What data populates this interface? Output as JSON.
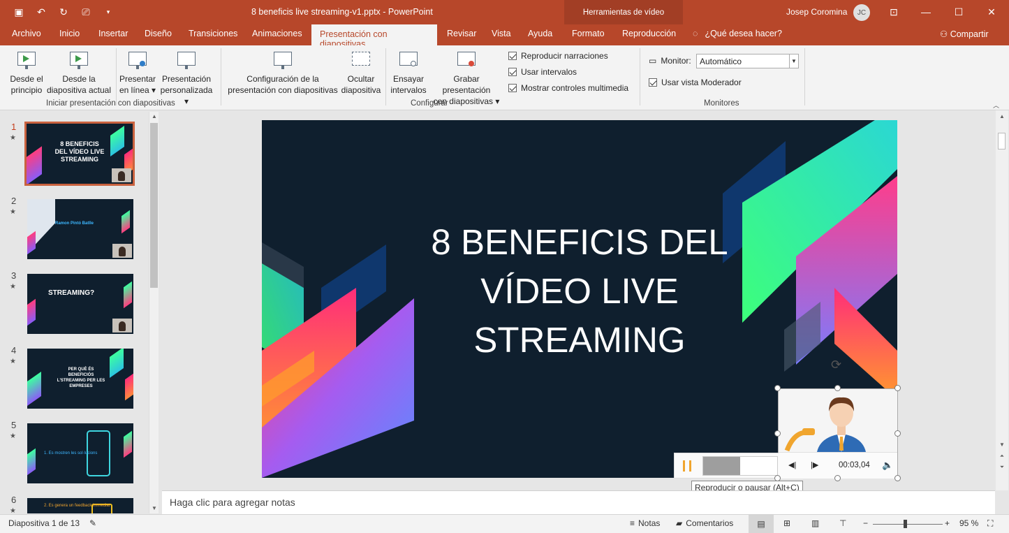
{
  "window": {
    "doc_title": "8 beneficis live streaming-v1.pptx  -  PowerPoint",
    "context_group": "Herramientas de vídeo",
    "user": "Josep Coromina",
    "user_initials": "JC"
  },
  "tabs": [
    {
      "label": "Archivo"
    },
    {
      "label": "Inicio"
    },
    {
      "label": "Insertar"
    },
    {
      "label": "Diseño"
    },
    {
      "label": "Transiciones"
    },
    {
      "label": "Animaciones"
    },
    {
      "label": "Presentación con diapositivas"
    },
    {
      "label": "Revisar"
    },
    {
      "label": "Vista"
    },
    {
      "label": "Ayuda"
    },
    {
      "label": "Formato"
    },
    {
      "label": "Reproducción"
    }
  ],
  "tell_me": "¿Qué desea hacer?",
  "share": "Compartir",
  "ribbon": {
    "btn_from_start": [
      "Desde el",
      "principio"
    ],
    "btn_from_current": [
      "Desde la",
      "diapositiva actual"
    ],
    "btn_present_online": [
      "Presentar",
      "en línea"
    ],
    "btn_custom": [
      "Presentación",
      "personalizada"
    ],
    "group_start": "Iniciar presentación con diapositivas",
    "btn_setup": [
      "Configuración de la",
      "presentación con diapositivas"
    ],
    "btn_hide": [
      "Ocultar",
      "diapositiva"
    ],
    "btn_rehearse": [
      "Ensayar",
      "intervalos"
    ],
    "btn_record": [
      "Grabar presentación",
      "con diapositivas"
    ],
    "chk_narrations": "Reproducir narraciones",
    "chk_timings": "Usar intervalos",
    "chk_media_controls": "Mostrar controles multimedia",
    "group_setup": "Configurar",
    "monitor_label": "Monitor:",
    "monitor_value": "Automático",
    "chk_presenter_view": "Usar vista Moderador",
    "group_monitors": "Monitores"
  },
  "thumbnails": [
    {
      "num": "1",
      "title": "8 BENEFICIS DEL VÍDEO LIVE STREAMING",
      "body": ""
    },
    {
      "num": "2",
      "title": "",
      "body": "Ramon Pintó Batlle"
    },
    {
      "num": "3",
      "title": "STREAMING?",
      "body": ""
    },
    {
      "num": "4",
      "title": "PER QUÈ ÉS BENEFICIÓS L'STREAMING PER LES EMPRESES",
      "body": ""
    },
    {
      "num": "5",
      "title": "",
      "body": "1. Es mostren les sol·lucions"
    },
    {
      "num": "6",
      "title": "",
      "body": "2. Es genera un feedback immediat"
    }
  ],
  "slide": {
    "title": "8 BENEFICIS DEL VÍDEO LIVE STREAMING"
  },
  "video": {
    "time": "00:03,04",
    "progress": 0.5,
    "tooltip": "Reproducir o pausar (Alt+C)"
  },
  "notes_placeholder": "Haga clic para agregar notas",
  "status": {
    "slide_count": "Diapositiva 1 de 13",
    "notes": "Notas",
    "comments": "Comentarios",
    "zoom": "95 %"
  },
  "colors": {
    "accent": "#b7472a",
    "slide_bg": "#0f1f2e"
  }
}
